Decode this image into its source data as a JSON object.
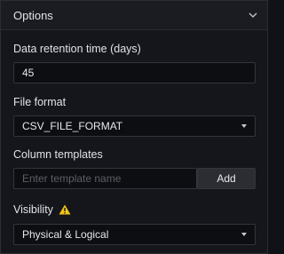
{
  "header": {
    "title": "Options",
    "toggle_icon": "chevron-down-icon"
  },
  "retention": {
    "label": "Data retention time (days)",
    "value": "45"
  },
  "file_format": {
    "label": "File format",
    "value": "CSV_FILE_FORMAT"
  },
  "column_templates": {
    "label": "Column templates",
    "placeholder": "Enter template name",
    "add_label": "Add"
  },
  "visibility": {
    "label": "Visibility",
    "icon": "warning-icon",
    "icon_color": "#f2c319",
    "value": "Physical & Logical"
  }
}
